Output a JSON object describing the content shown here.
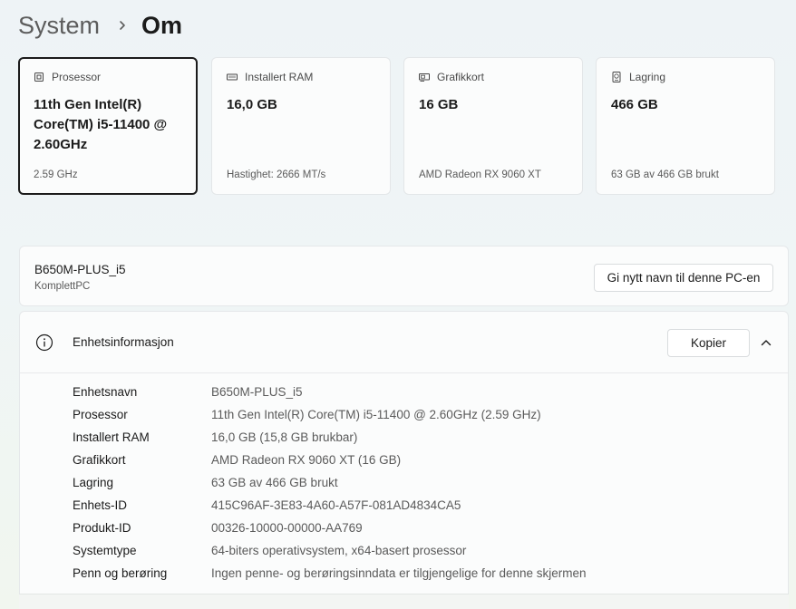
{
  "breadcrumb": {
    "parent": "System",
    "current": "Om"
  },
  "spec_cards": [
    {
      "icon": "processor-icon",
      "title": "Prosessor",
      "value": "11th Gen Intel(R) Core(TM) i5-11400 @ 2.60GHz",
      "sub": "2.59 GHz",
      "selected": true
    },
    {
      "icon": "ram-icon",
      "title": "Installert RAM",
      "value": "16,0 GB",
      "sub": "Hastighet: 2666 MT/s",
      "selected": false
    },
    {
      "icon": "graphics-card-icon",
      "title": "Grafikkort",
      "value": "16 GB",
      "sub": "AMD Radeon RX 9060 XT",
      "selected": false
    },
    {
      "icon": "storage-icon",
      "title": "Lagring",
      "value": "466 GB",
      "sub": "63 GB av 466 GB brukt",
      "selected": false
    }
  ],
  "pc": {
    "name": "B650M-PLUS_i5",
    "manufacturer": "KomplettPC",
    "rename_label": "Gi nytt navn til denne PC-en"
  },
  "device_info": {
    "title": "Enhetsinformasjon",
    "copy_label": "Kopier",
    "rows": [
      {
        "label": "Enhetsnavn",
        "value": "B650M-PLUS_i5"
      },
      {
        "label": "Prosessor",
        "value": "11th Gen Intel(R) Core(TM) i5-11400 @ 2.60GHz (2.59 GHz)"
      },
      {
        "label": "Installert RAM",
        "value": "16,0 GB (15,8 GB brukbar)"
      },
      {
        "label": "Grafikkort",
        "value": "AMD Radeon RX 9060 XT (16 GB)"
      },
      {
        "label": "Lagring",
        "value": "63 GB av 466 GB brukt"
      },
      {
        "label": "Enhets-ID",
        "value": "415C96AF-3E83-4A60-A57F-081AD4834CA5"
      },
      {
        "label": "Produkt-ID",
        "value": "00326-10000-00000-AA769"
      },
      {
        "label": "Systemtype",
        "value": "64-biters operativsystem, x64-basert prosessor"
      },
      {
        "label": "Penn og berøring",
        "value": "Ingen penne- og berøringsinndata er tilgjengelige for denne skjermen"
      }
    ]
  }
}
